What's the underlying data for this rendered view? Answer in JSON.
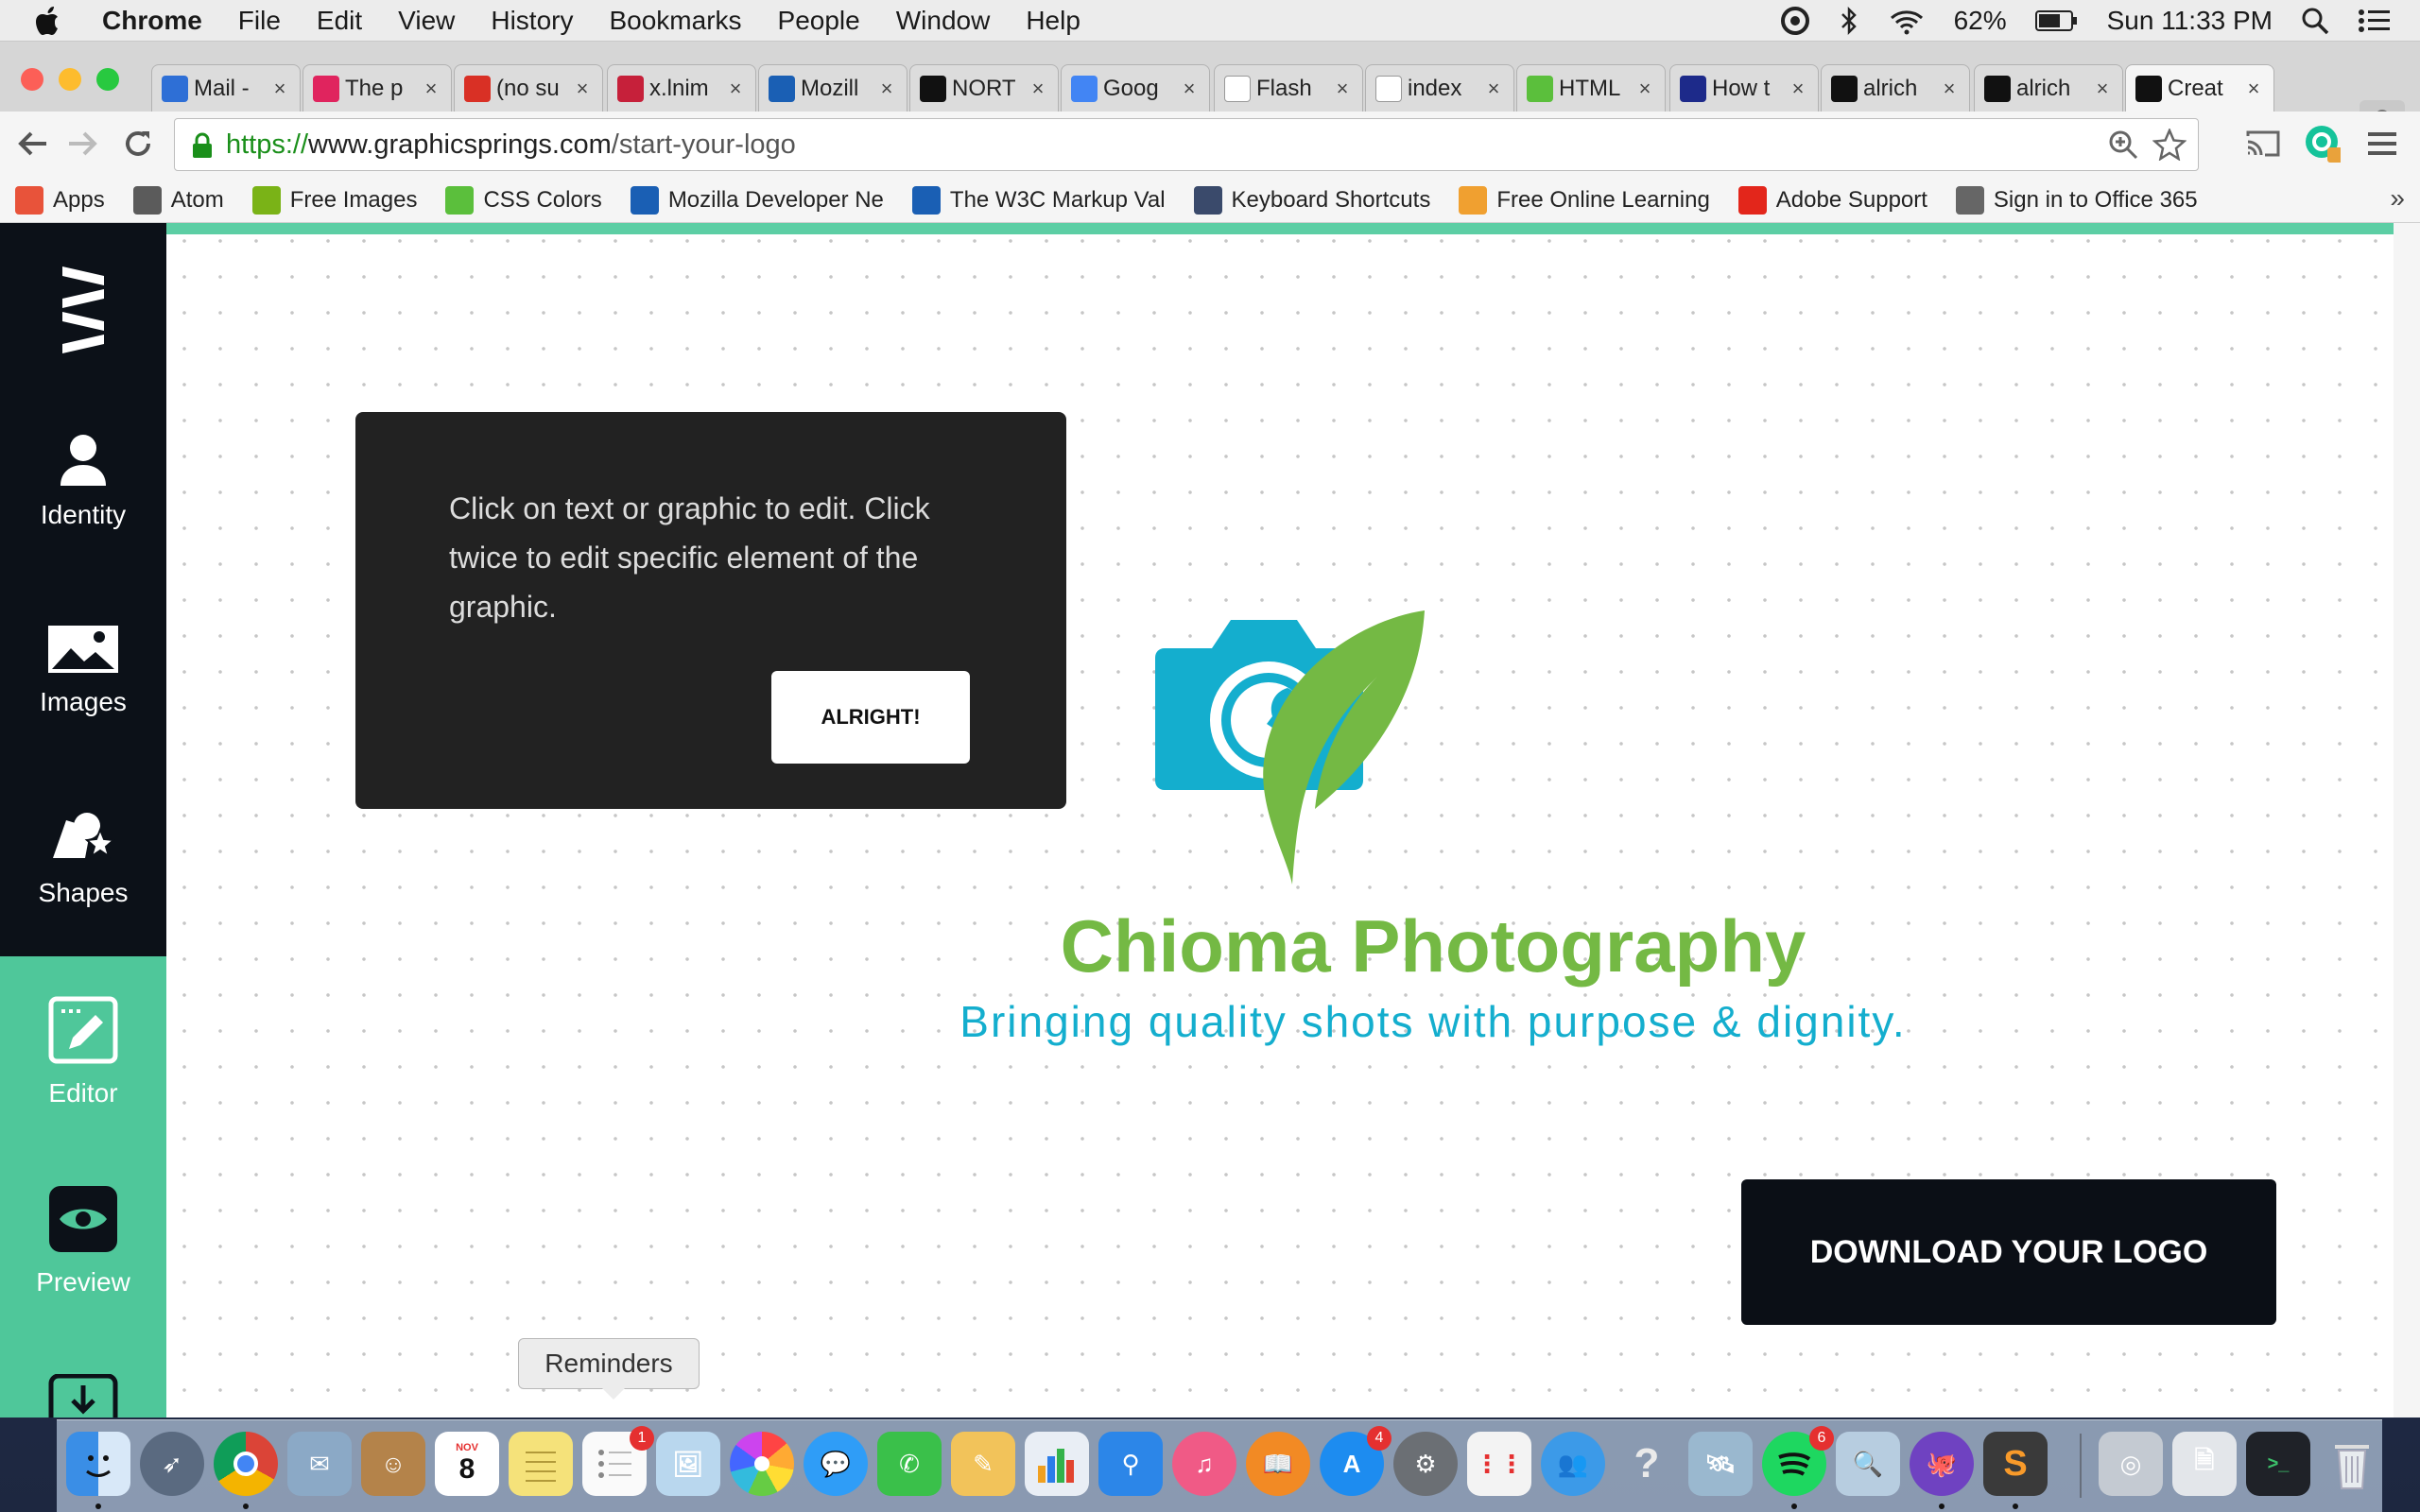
{
  "menubar": {
    "app": "Chrome",
    "items": [
      "File",
      "Edit",
      "View",
      "History",
      "Bookmarks",
      "People",
      "Window",
      "Help"
    ],
    "battery": "62%",
    "clock": "Sun 11:33 PM"
  },
  "tabs": [
    {
      "title": "Mail - ",
      "icon": "mail-icon",
      "color": "#2e6fd6"
    },
    {
      "title": "The p",
      "icon": "jo-icon",
      "color": "#e0245e"
    },
    {
      "title": "(no su",
      "icon": "gmail-icon",
      "color": "#d93025"
    },
    {
      "title": "x.lnim",
      "icon": "puzzle-icon",
      "color": "#c6203a"
    },
    {
      "title": "Mozill",
      "icon": "mozilla-icon",
      "color": "#1a5fb4"
    },
    {
      "title": "NORT",
      "icon": "nort-icon",
      "color": "#111111"
    },
    {
      "title": "Goog",
      "icon": "google-icon",
      "color": "#4285f4"
    },
    {
      "title": "Flash",
      "icon": "page-icon",
      "color": "#ffffff"
    },
    {
      "title": "index",
      "icon": "page-icon",
      "color": "#ffffff"
    },
    {
      "title": "HTML",
      "icon": "w3-icon",
      "color": "#5bbf3c"
    },
    {
      "title": "How t",
      "icon": "wizard-icon",
      "color": "#1d2a8a"
    },
    {
      "title": "alrich",
      "icon": "github-icon",
      "color": "#111111"
    },
    {
      "title": "alrich",
      "icon": "github-icon",
      "color": "#111111"
    },
    {
      "title": "Creat",
      "icon": "graphicsprings-icon",
      "color": "#111111"
    }
  ],
  "address": {
    "scheme": "https://",
    "host": "www.graphicsprings.com",
    "path": "/start-your-logo"
  },
  "bookmarks": [
    {
      "label": "Apps",
      "icon": "apps-grid-icon",
      "color": "#e8533a"
    },
    {
      "label": "Atom",
      "icon": "atom-icon",
      "color": "#5b5b5b"
    },
    {
      "label": "Free Images",
      "icon": "free-images-icon",
      "color": "#7ab317"
    },
    {
      "label": "CSS Colors",
      "icon": "w3schools-icon",
      "color": "#5bbf3c"
    },
    {
      "label": "Mozilla Developer Ne",
      "icon": "mozilla-icon",
      "color": "#1a5fb4"
    },
    {
      "label": "The W3C Markup Val",
      "icon": "w3c-icon",
      "color": "#1a5fb4"
    },
    {
      "label": "Keyboard Shortcuts",
      "icon": "keyboard-icon",
      "color": "#3a4a6b"
    },
    {
      "label": "Free Online Learning",
      "icon": "learning-icon",
      "color": "#f0a030"
    },
    {
      "label": "Adobe Support",
      "icon": "adobe-icon",
      "color": "#e3261b"
    },
    {
      "label": "Sign in to Office 365",
      "icon": "office-icon",
      "color": "#666666"
    }
  ],
  "sidebar": {
    "items": [
      {
        "label": "Identity",
        "icon": "person-icon"
      },
      {
        "label": "Images",
        "icon": "image-icon"
      },
      {
        "label": "Shapes",
        "icon": "shapes-icon"
      },
      {
        "label": "Editor",
        "icon": "edit-icon"
      },
      {
        "label": "Preview",
        "icon": "eye-icon"
      }
    ]
  },
  "tip": {
    "text": "Click on text or graphic to edit. Click twice to edit specific element of the graphic.",
    "button": "ALRIGHT!"
  },
  "logo": {
    "company": "Chioma Photography",
    "tagline": "Bringing quality shots with purpose & dignity.",
    "green": "#74b944",
    "blue": "#14aece"
  },
  "download_button": "DOWNLOAD YOUR LOGO",
  "dock": {
    "tooltip": "Reminders",
    "calendar_month": "NOV",
    "calendar_day": "8",
    "badges": {
      "reminders": "1",
      "appstore": "4",
      "spotify": "6"
    }
  }
}
